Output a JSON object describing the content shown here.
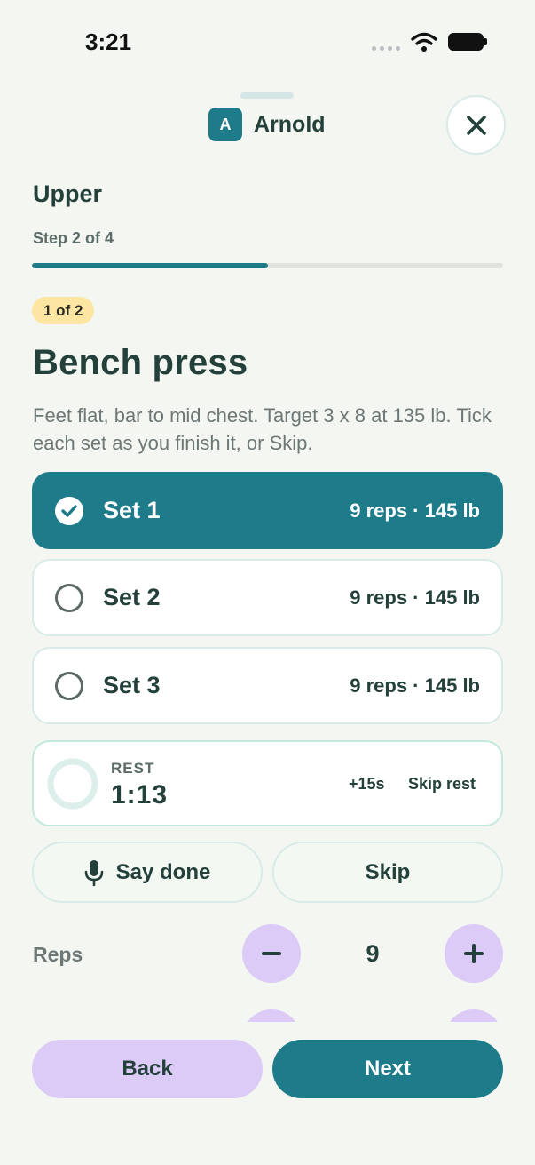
{
  "status_bar": {
    "time": "3:21"
  },
  "header": {
    "avatar_initial": "A",
    "user_name": "Arnold",
    "close_icon": "close-icon"
  },
  "workout": {
    "title": "Upper",
    "step_label": "Step 2 of 4",
    "progress_fraction": 0.5
  },
  "exercise": {
    "badge": "1 of 2",
    "title": "Bench press",
    "description": "Feet flat, bar to mid chest. Target 3 x 8 at 135 lb. Tick each set as you finish it, or Skip."
  },
  "sets": [
    {
      "name": "Set 1",
      "detail": "9 reps · 145 lb",
      "done": true
    },
    {
      "name": "Set 2",
      "detail": "9 reps · 145 lb",
      "done": false
    },
    {
      "name": "Set 3",
      "detail": "9 reps · 145 lb",
      "done": false
    }
  ],
  "rest": {
    "label": "REST",
    "time": "1:13",
    "add_label": "+15s",
    "skip_label": "Skip rest"
  },
  "actions": {
    "say_done": "Say done",
    "skip": "Skip"
  },
  "reps": {
    "label": "Reps",
    "value": "9"
  },
  "footer": {
    "back": "Back",
    "next": "Next"
  },
  "colors": {
    "accent": "#1e7b8a",
    "lavender": "#dccbf7",
    "badge": "#fde5a2",
    "background": "#f3f6f1"
  }
}
